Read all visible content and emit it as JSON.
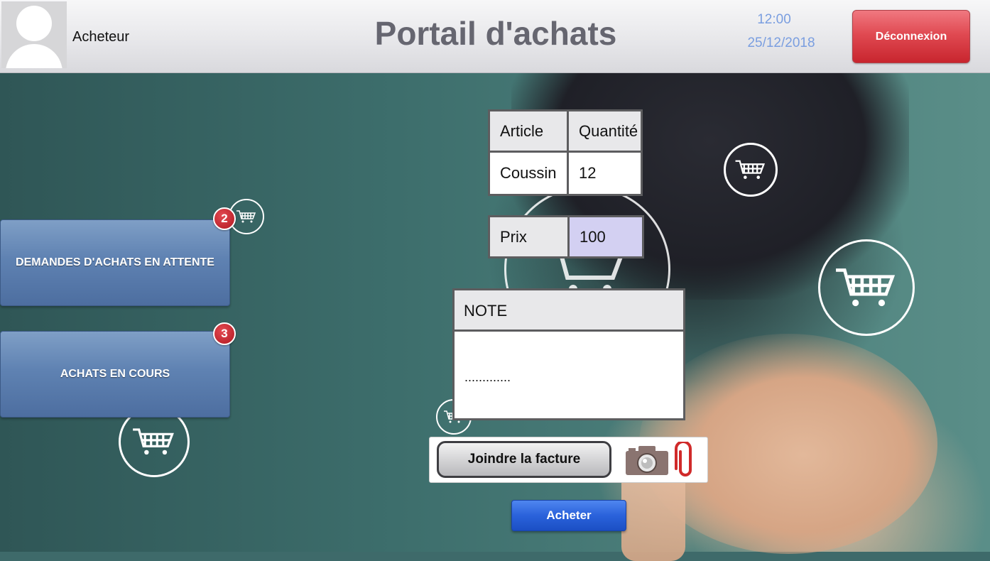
{
  "header": {
    "role": "Acheteur",
    "title": "Portail d'achats",
    "time": "12:00",
    "date": "25/12/2018",
    "logout_label": "Déconnexion"
  },
  "menu": {
    "pending_requests": {
      "label": "DEMANDES D'ACHATS EN ATTENTE",
      "badge": "2"
    },
    "in_progress": {
      "label": "ACHATS EN COURS",
      "badge": "3"
    }
  },
  "order": {
    "headers": [
      "Article",
      "Quantité"
    ],
    "article": "Coussin",
    "quantity": "12",
    "price_label": "Prix",
    "price": "100"
  },
  "note": {
    "label": "NOTE",
    "value": "............."
  },
  "attach": {
    "button_label": "Joindre la facture",
    "icons": [
      "camera-icon",
      "paperclip-icon"
    ]
  },
  "buy_label": "Acheter",
  "colors": {
    "accent_blue": "#2a62db",
    "logout_red": "#d0303a",
    "menu_blue": "#5f82b2",
    "price_bg": "#d3d0f2",
    "clock_text": "#7a9ee0"
  }
}
